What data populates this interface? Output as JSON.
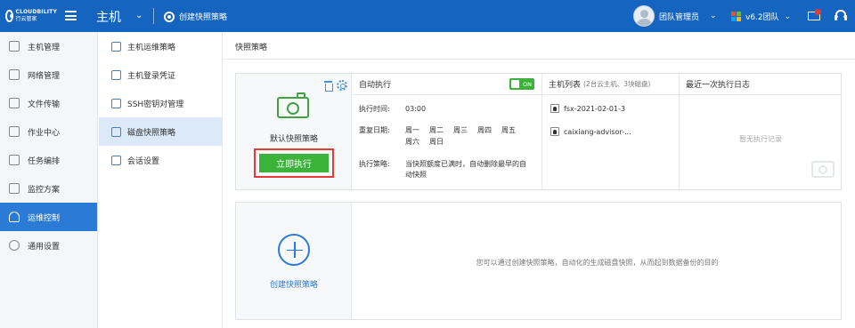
{
  "topbar": {
    "logo_text_en": "CLOUDBILITY",
    "logo_text_cn": "行云管家",
    "module_title": "主机",
    "create_policy_label": "创建快照策略",
    "user_name": "团队管理员",
    "team_name": "v6.2团队"
  },
  "left_nav": {
    "items": [
      {
        "label": "主机管理",
        "icon": "monitor-icon"
      },
      {
        "label": "网络管理",
        "icon": "network-icon"
      },
      {
        "label": "文件传输",
        "icon": "file-transfer-icon"
      },
      {
        "label": "作业中心",
        "icon": "job-icon"
      },
      {
        "label": "任务编排",
        "icon": "task-icon"
      },
      {
        "label": "监控方案",
        "icon": "monitor-chart-icon"
      },
      {
        "label": "运维控制",
        "icon": "shield-icon",
        "active": true
      },
      {
        "label": "通用设置",
        "icon": "gear-icon"
      }
    ]
  },
  "sub_nav": {
    "items": [
      {
        "label": "主机运维策略",
        "icon": "shield-icon"
      },
      {
        "label": "主机登录凭证",
        "icon": "credential-icon"
      },
      {
        "label": "SSH密钥对管理",
        "icon": "key-icon"
      },
      {
        "label": "磁盘快照策略",
        "icon": "disk-icon",
        "active": true
      },
      {
        "label": "会话设置",
        "icon": "window-icon"
      }
    ]
  },
  "main": {
    "breadcrumb": "快照策略",
    "policy_card": {
      "name": "默认快照策略",
      "run_button": "立即执行",
      "auto_exec": {
        "title": "自动执行",
        "toggle": "ON",
        "time_label": "执行时间:",
        "time_value": "03:00",
        "repeat_label": "重复日期:",
        "days": [
          "周一",
          "周二",
          "周三",
          "周四",
          "周五",
          "周六",
          "周日"
        ],
        "strategy_label": "执行策略:",
        "strategy_value": "当快照额度已满时，自动删除最早的自动快照"
      },
      "hosts": {
        "title": "主机列表",
        "hint": "(2台云主机、3块磁盘)",
        "items": [
          "fsx-2021-02-01-3",
          "caixiang-advisor-..."
        ]
      },
      "log": {
        "title": "最近一次执行日志",
        "empty": "暂无执行记录"
      }
    },
    "create_card": {
      "label": "创建快照策略",
      "description": "您可以通过创建快照策略，自动化的生成磁盘快照，从而起到数据备份的目的"
    }
  },
  "colors": {
    "topbar": "#1565c0",
    "active_nav": "#2b7bd6",
    "run_button": "#3bb33b",
    "highlight": "#e53935"
  }
}
